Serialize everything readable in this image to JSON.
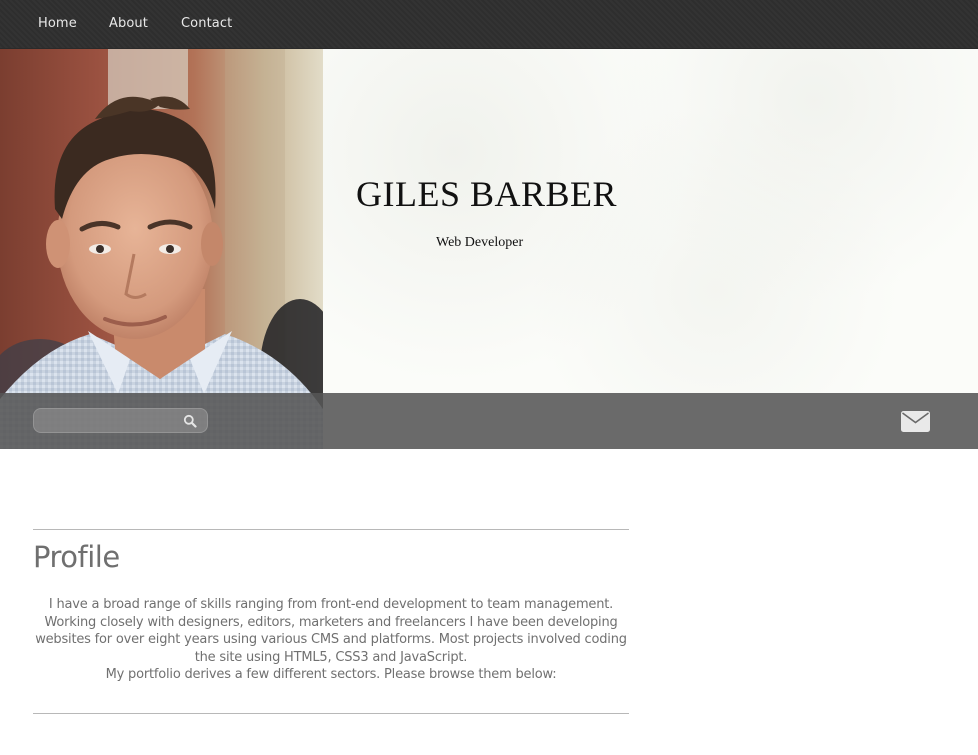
{
  "nav": {
    "items": [
      {
        "label": "Home"
      },
      {
        "label": "About"
      },
      {
        "label": "Contact"
      }
    ]
  },
  "hero": {
    "name": "GILES BARBER",
    "role": "Web Developer"
  },
  "search": {
    "value": "",
    "placeholder": "",
    "icon": "search-icon"
  },
  "contact": {
    "icon": "mail-icon"
  },
  "profile": {
    "title": "Profile",
    "paragraph": "I have a broad range of skills ranging from front-end development to team management. Working closely with designers, editors, marketers and freelancers I have been developing websites for over eight years using various CMS and platforms. Most projects involved coding the site using HTML5, CSS3 and JavaScript.",
    "portfolio_line": "My portfolio derives a few different sectors. Please browse them below:"
  },
  "colors": {
    "nav_bg": "#333333",
    "toolbar_bg": "#555555",
    "hero_bg": "#fbfcf9",
    "heading_text": "#6f6f6f",
    "body_text": "#707070"
  }
}
